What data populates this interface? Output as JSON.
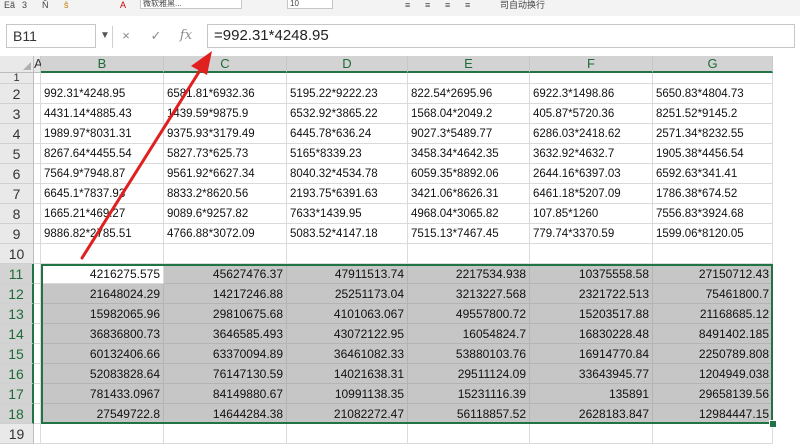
{
  "ribbon": {
    "items": [
      "Eã",
      "3",
      "Ň",
      "ŝ",
      "A",
      "≡",
      "≡",
      "≡",
      "≡"
    ],
    "font_box": "微软雅黑...",
    "size_box": "10",
    "right_text": [
      "司自动换",
      "行"
    ]
  },
  "formula_bar": {
    "name_box": "B11",
    "cancel_icon": "×",
    "enter_icon": "✓",
    "fx_icon": "fx",
    "formula": "=992.31*4248.95"
  },
  "columns": [
    "A",
    "B",
    "C",
    "D",
    "E",
    "F",
    "G"
  ],
  "rows": [
    {
      "num": "1",
      "cells": [
        "",
        "",
        "",
        "",
        "",
        ""
      ]
    },
    {
      "num": "2",
      "cells": [
        "992.31*4248.95",
        "6581.81*6932.36",
        "5195.22*9222.23",
        "822.54*2695.96",
        "6922.3*1498.86",
        "5650.83*4804.73"
      ]
    },
    {
      "num": "3",
      "cells": [
        "4431.14*4885.43",
        "1439.59*9875.9",
        "6532.92*3865.22",
        "1568.04*2049.2",
        "405.87*5720.36",
        "8251.52*9145.2"
      ]
    },
    {
      "num": "4",
      "cells": [
        "1989.97*8031.31",
        "9375.93*3179.49",
        "6445.78*636.24",
        "9027.3*5489.77",
        "6286.03*2418.62",
        "2571.34*8232.55"
      ]
    },
    {
      "num": "5",
      "cells": [
        "8267.64*4455.54",
        "5827.73*625.73",
        "5165*8339.23",
        "3458.34*4642.35",
        "3632.92*4632.7",
        "1905.38*4456.54"
      ]
    },
    {
      "num": "6",
      "cells": [
        "7564.9*7948.87",
        "9561.92*6627.34",
        "8040.32*4534.78",
        "6059.35*8892.06",
        "2644.16*6397.03",
        "6592.63*341.41"
      ]
    },
    {
      "num": "7",
      "cells": [
        "6645.1*7837.93",
        "8833.2*8620.56",
        "2193.75*6391.63",
        "3421.06*8626.31",
        "6461.18*5207.09",
        "1786.38*674.52"
      ]
    },
    {
      "num": "8",
      "cells": [
        "1665.21*469.27",
        "9089.6*9257.82",
        "7633*1439.95",
        "4968.04*3065.82",
        "107.85*1260",
        "7556.83*3924.68"
      ]
    },
    {
      "num": "9",
      "cells": [
        "9886.82*2785.51",
        "4766.88*3072.09",
        "5083.52*4147.18",
        "7515.13*7467.45",
        "779.74*3370.59",
        "1599.06*8120.05"
      ]
    },
    {
      "num": "10",
      "cells": [
        "",
        "",
        "",
        "",
        "",
        ""
      ]
    },
    {
      "num": "11",
      "cells": [
        "4216275.575",
        "45627476.37",
        "47911513.74",
        "2217534.938",
        "10375558.58",
        "27150712.43"
      ]
    },
    {
      "num": "12",
      "cells": [
        "21648024.29",
        "14217246.88",
        "25251173.04",
        "3213227.568",
        "2321722.513",
        "75461800.7"
      ]
    },
    {
      "num": "13",
      "cells": [
        "15982065.96",
        "29810675.68",
        "4101063.067",
        "49557800.72",
        "15203517.88",
        "21168685.12"
      ]
    },
    {
      "num": "14",
      "cells": [
        "36836800.73",
        "3646585.493",
        "43072122.95",
        "16054824.7",
        "16830228.48",
        "8491402.185"
      ]
    },
    {
      "num": "15",
      "cells": [
        "60132406.66",
        "63370094.89",
        "36461082.33",
        "53880103.76",
        "16914770.84",
        "2250789.808"
      ]
    },
    {
      "num": "16",
      "cells": [
        "52083828.64",
        "76147130.59",
        "14021638.31",
        "29511124.09",
        "33643945.77",
        "1204949.038"
      ]
    },
    {
      "num": "17",
      "cells": [
        "781433.0967",
        "84149880.67",
        "10991138.35",
        "15231116.39",
        "135891",
        "29658139.56"
      ]
    },
    {
      "num": "18",
      "cells": [
        "27549722.8",
        "14644284.38",
        "21082272.47",
        "56118857.52",
        "2628183.847",
        "12984447.15"
      ]
    },
    {
      "num": "19",
      "cells": [
        "",
        "",
        "",
        "",
        "",
        ""
      ]
    }
  ],
  "colors": {
    "selection_border": "#217346",
    "selection_fill": "#c6c6c6",
    "annotation_arrow": "#e0201e"
  }
}
